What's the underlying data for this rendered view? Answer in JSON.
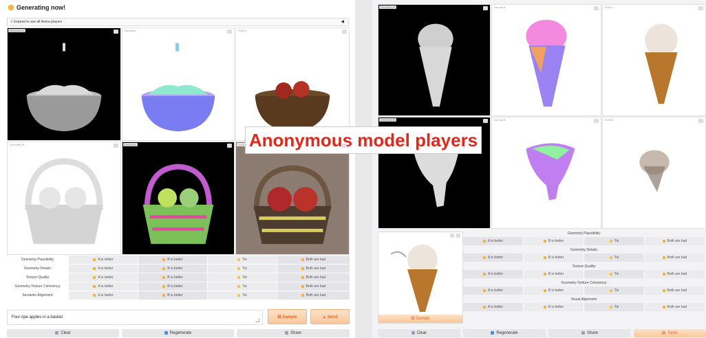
{
  "left": {
    "title": "Generating now!",
    "expand_label": "Expand to see all Arena players",
    "tiles": {
      "geometry_a": "Geometry A",
      "normal_a": "Normal A",
      "rgb_a": "RGB A",
      "geometry_b": "Geometry B",
      "normal_b": "Normal B",
      "rgb_b": "RGB B"
    },
    "vote_rows": [
      {
        "label": "Geometry Plausibility:"
      },
      {
        "label": "Geometry Details:"
      },
      {
        "label": "Texture Quality:"
      },
      {
        "label": "Geometry-Texture Coherency:"
      },
      {
        "label": "Semantic Alignment:"
      }
    ],
    "buttons": {
      "a_better": "A is better",
      "b_better": "B is better",
      "tie": "Tie",
      "both_bad": "Both are bad"
    },
    "prompt_value": "Four ripe apples in a basket",
    "sample": "Sample",
    "send": "Send",
    "clear": "Clear",
    "regenerate": "Regenerate",
    "share": "Share"
  },
  "banner": "Anonymous model players",
  "right": {
    "tiles": {
      "geometry_a": "Geometry A",
      "normal_a": "Normal A",
      "rgb_a": "RGB A",
      "geometry_b": "Geometry B",
      "normal_b": "Normal B",
      "rgb_b": "RGB B"
    },
    "groups": [
      {
        "label": "Geometry Plausibility:"
      },
      {
        "label": "Geometry Details:"
      },
      {
        "label": "Texture Quality:"
      },
      {
        "label": "Geometry-Texture Coherency:"
      },
      {
        "label": "Visual Alignment:"
      }
    ],
    "buttons": {
      "a_better": "A is better",
      "b_better": "B is better",
      "tie": "Tie",
      "both_bad": "Both are bad"
    },
    "sample": "Sample",
    "clear": "Clear",
    "regenerate": "Regenerate",
    "share": "Share",
    "send": "Send"
  },
  "colors": {
    "accent_orange": "#e06a2a",
    "banner_red": "#e0291d"
  }
}
